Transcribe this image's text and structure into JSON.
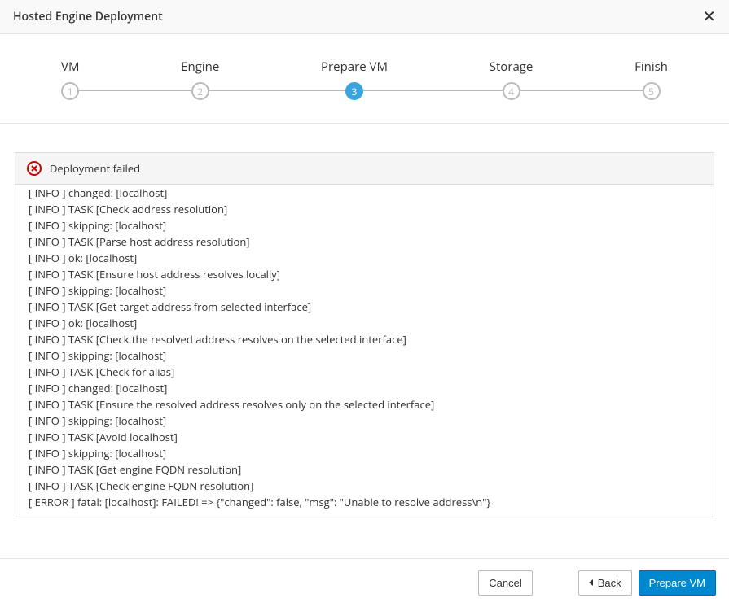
{
  "header": {
    "title": "Hosted Engine Deployment"
  },
  "wizard": {
    "steps": [
      {
        "label": "VM",
        "num": "1"
      },
      {
        "label": "Engine",
        "num": "2"
      },
      {
        "label": "Prepare VM",
        "num": "3"
      },
      {
        "label": "Storage",
        "num": "4"
      },
      {
        "label": "Finish",
        "num": "5"
      }
    ],
    "activeIndex": 2
  },
  "status": {
    "text": "Deployment failed",
    "icon": "error-circle"
  },
  "log": [
    "[ INFO ] changed: [localhost]",
    "[ INFO ] TASK [Check address resolution]",
    "[ INFO ] skipping: [localhost]",
    "[ INFO ] TASK [Parse host address resolution]",
    "[ INFO ] ok: [localhost]",
    "[ INFO ] TASK [Ensure host address resolves locally]",
    "[ INFO ] skipping: [localhost]",
    "[ INFO ] TASK [Get target address from selected interface]",
    "[ INFO ] ok: [localhost]",
    "[ INFO ] TASK [Check the resolved address resolves on the selected interface]",
    "[ INFO ] skipping: [localhost]",
    "[ INFO ] TASK [Check for alias]",
    "[ INFO ] changed: [localhost]",
    "[ INFO ] TASK [Ensure the resolved address resolves only on the selected interface]",
    "[ INFO ] skipping: [localhost]",
    "[ INFO ] TASK [Avoid localhost]",
    "[ INFO ] skipping: [localhost]",
    "[ INFO ] TASK [Get engine FQDN resolution]",
    "[ INFO ] TASK [Check engine FQDN resolution]",
    "[ ERROR ] fatal: [localhost]: FAILED! => {\"changed\": false, \"msg\": \"Unable to resolve address\\n\"}"
  ],
  "footer": {
    "cancel": "Cancel",
    "back": "Back",
    "primary": "Prepare VM"
  }
}
